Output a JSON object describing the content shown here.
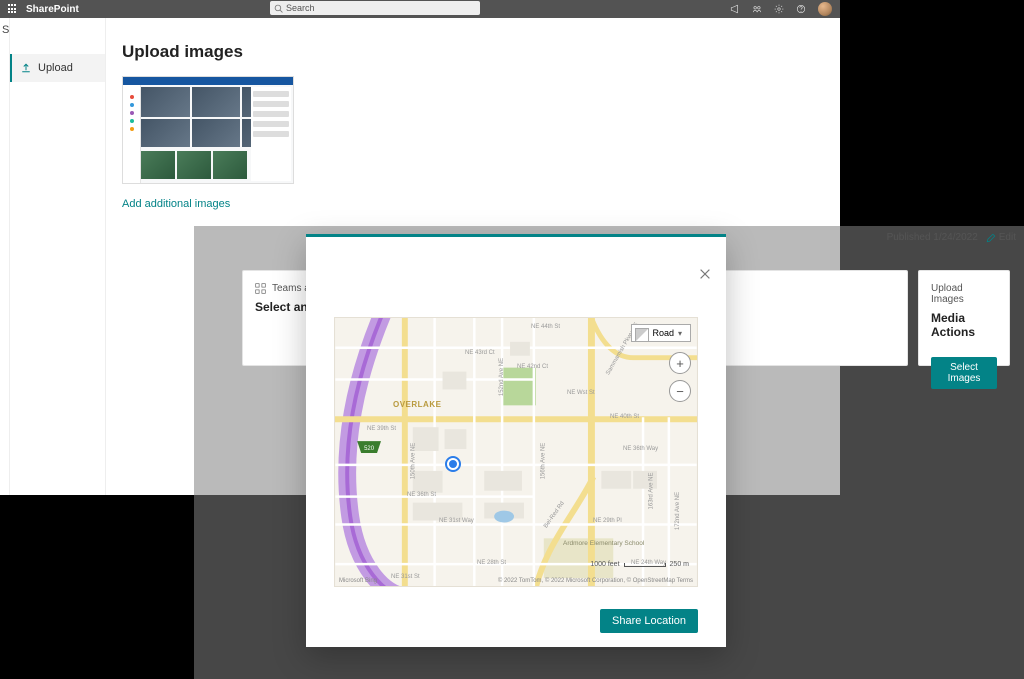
{
  "suitebar": {
    "brand": "SharePoint",
    "search_placeholder": "Search"
  },
  "sidenav": {
    "initial": "S",
    "upload_label": "Upload"
  },
  "upload_panel": {
    "title": "Upload images",
    "add_link": "Add additional images"
  },
  "page2": {
    "published": "Published 1/24/2022",
    "edit_label": "Edit",
    "cards": {
      "teams": {
        "head": "Teams app",
        "desc": "Select an app fr"
      },
      "media": {
        "head": "Upload Images",
        "title": "Media Actions",
        "button": "Select Images"
      }
    }
  },
  "modal": {
    "map_style": "Road",
    "zoom_in": "+",
    "zoom_out": "−",
    "scale_left": "1000 feet",
    "scale_right": "250 m",
    "credits_left": "Microsoft Bing",
    "credits_right": "© 2022 TomTom, © 2022 Microsoft Corporation,  © OpenStreetMap  Terms",
    "share_button": "Share Location",
    "labels": {
      "overlake": "OVERLAKE",
      "ne44": "NE 44th St",
      "ne43": "NE 43rd Ct",
      "ne42": "NE 42nd Ct",
      "ne40": "NE 40th St",
      "ne39": "NE 39th St",
      "ne36w": "NE 36th Way",
      "ne36": "NE 36th St",
      "ne31w": "NE 31st Way",
      "ne31": "NE 31st St",
      "ne29": "NE 29th Pl",
      "ne28": "NE 28th St",
      "ne24": "NE 24th Way",
      "ave150": "150th Ave NE",
      "ave152": "152nd Ave NE",
      "ave156": "156th Ave NE",
      "ave163": "163rd Ave NE",
      "ave172": "172nd Ave NE",
      "pkwy": "Sammamish Pkwy NE",
      "belred": "Bel-Red Rd",
      "sr520": "520",
      "school": "Ardmore\nElementary\nSchool"
    }
  }
}
